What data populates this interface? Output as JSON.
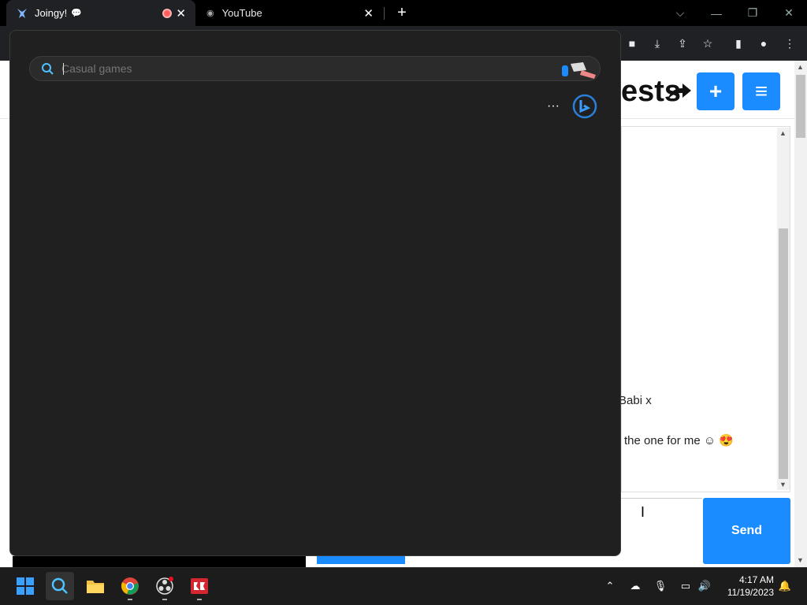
{
  "browser": {
    "tabs": [
      {
        "label": "Joingy!",
        "active": true
      },
      {
        "label": "YouTube",
        "active": false
      }
    ],
    "new_tab_label": "+"
  },
  "page": {
    "brand_fragment": "ests",
    "messages": [
      {
        "text": "Babi x"
      },
      {
        "text": "the one for me ☺ 😍"
      }
    ],
    "send_label": "Send"
  },
  "search": {
    "placeholder": "Casual games",
    "more_label": "···"
  },
  "taskbar": {
    "time": "4:17 AM",
    "date": "11/19/2023"
  },
  "colors": {
    "accent_blue": "#1a8cff",
    "overlay_bg": "#202020",
    "taskbar_bg": "#1c1c1c"
  }
}
